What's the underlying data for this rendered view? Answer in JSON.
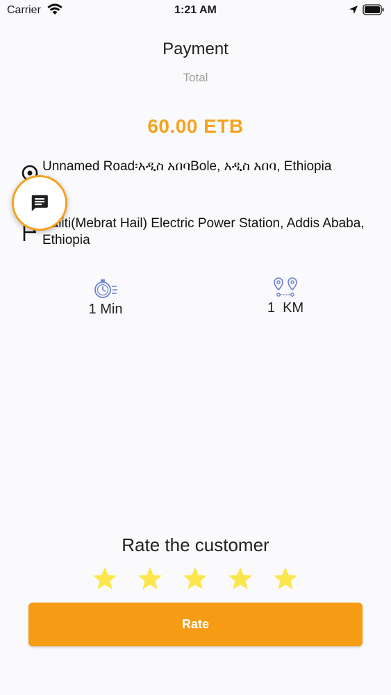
{
  "status_bar": {
    "carrier": "Carrier",
    "time": "1:21 AM"
  },
  "header": {
    "title": "Payment",
    "total_label": "Total"
  },
  "amount": "60.00 ETB",
  "trip": {
    "pickup_address": "Unnamed Road፡አዲስ አበባBole, አዲስ አበባ, Ethiopia",
    "dropoff_address": "Kaliti(Mebrat Hail) Electric Power Station, Addis Ababa, Ethiopia"
  },
  "metrics": {
    "time": "1 Min",
    "distance": "1  KM"
  },
  "rating": {
    "title": "Rate the customer",
    "stars_selected": 5,
    "stars_total": 5
  },
  "actions": {
    "rate_label": "Rate"
  },
  "colors": {
    "accent": "#f4a31f",
    "button": "#f59b14",
    "star": "#fbe74b",
    "icon_blue": "#6b7fd6"
  },
  "icons": {
    "chat": "chat-icon",
    "time": "stopwatch-icon",
    "distance": "route-pins-icon",
    "pickup": "location-pin-icon",
    "dropoff": "flag-icon",
    "star": "star-icon"
  }
}
